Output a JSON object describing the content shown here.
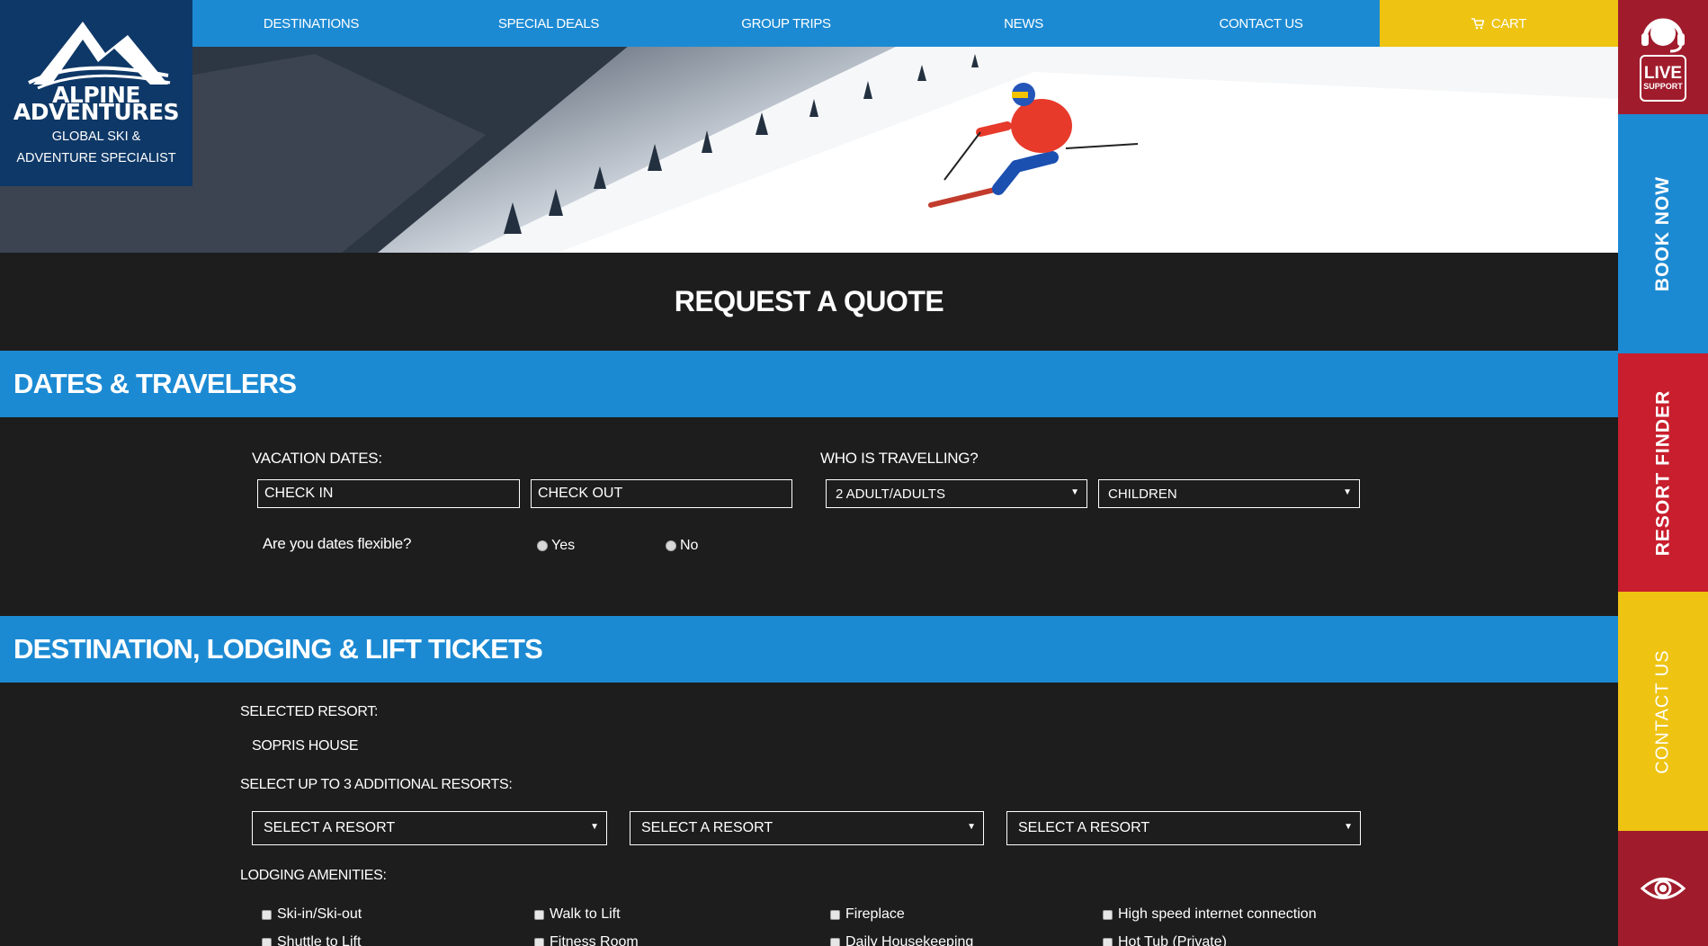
{
  "nav": {
    "items": [
      "DESTINATIONS",
      "SPECIAL DEALS",
      "GROUP TRIPS",
      "NEWS",
      "CONTACT US"
    ],
    "cart_label": "CART"
  },
  "logo": {
    "line1": "ALPINE",
    "line2": "ADVENTURES",
    "tagline1": "GLOBAL SKI &",
    "tagline2": "ADVENTURE SPECIALIST"
  },
  "rail": {
    "live_line1": "LIVE",
    "live_line2": "SUPPORT",
    "book_now": "BOOK NOW",
    "resort_finder": "RESORT FINDER",
    "contact_us": "CONTACT US",
    "eye_icon": "eye-icon"
  },
  "page_title": "REQUEST A QUOTE",
  "dates_section": {
    "heading": "DATES & TRAVELERS",
    "vacation_label": "VACATION DATES:",
    "check_in_placeholder": "CHECK IN",
    "check_out_placeholder": "CHECK OUT",
    "who_label": "WHO IS TRAVELLING?",
    "adults_value": "2 ADULT/ADULTS",
    "children_value": "CHILDREN",
    "flexible_question": "Are you dates flexible?",
    "yes_label": "Yes",
    "no_label": "No"
  },
  "destination_section": {
    "heading": "DESTINATION, LODGING & LIFT TICKETS",
    "selected_resort_label": "SELECTED RESORT:",
    "selected_resort_value": "SOPRIS HOUSE",
    "additional_label": "SELECT UP TO 3 ADDITIONAL RESORTS:",
    "resort_selects": [
      "SELECT A RESORT",
      "SELECT A RESORT",
      "SELECT A RESORT"
    ],
    "amenities_label": "LODGING AMENITIES:",
    "amenities_row1": [
      "Ski-in/Ski-out",
      "Walk to Lift",
      "Fireplace",
      "High speed internet connection"
    ],
    "amenities_row2": [
      "Shuttle to Lift",
      "Fitness Room",
      "Daily Housekeeping",
      "Hot Tub (Private)"
    ]
  },
  "colors": {
    "nav_blue": "#1c8ad3",
    "cart_yellow": "#eec312",
    "logo_navy": "#0e3867",
    "rail_red": "#c81e2d",
    "rail_dark_red": "#a01c2c",
    "background": "#1d1d1d"
  }
}
